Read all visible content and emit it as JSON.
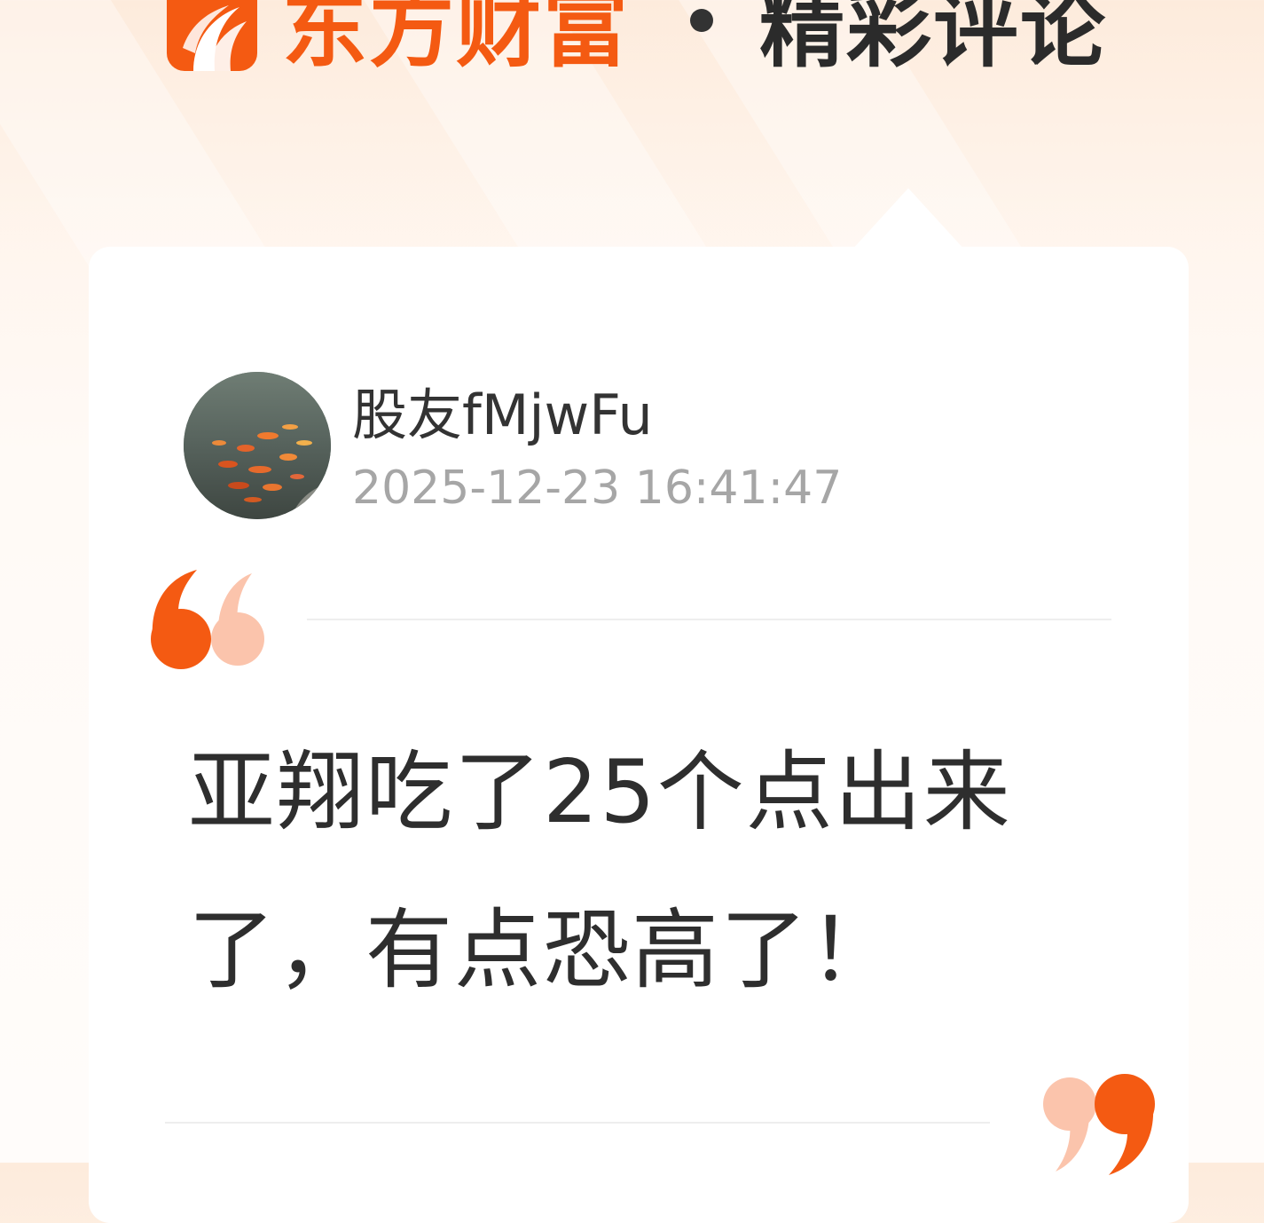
{
  "header": {
    "brand_name": "东方财富",
    "section_title": "精彩评论",
    "logo_icon": "eastmoney-logo-icon",
    "brand_color": "#f45a12"
  },
  "comment": {
    "username": "股友fMjwFu",
    "timestamp": "2025-12-23 16:41:47",
    "avatar_icon": "koi-fish-pond-avatar",
    "text": "亚翔吃了25个点出来了，有点恐高了！"
  },
  "decor": {
    "open_quote_icon": "open-quote-icon",
    "close_quote_icon": "close-quote-icon",
    "quote_primary_color": "#f45a12",
    "quote_secondary_color": "#fbc4ac"
  }
}
